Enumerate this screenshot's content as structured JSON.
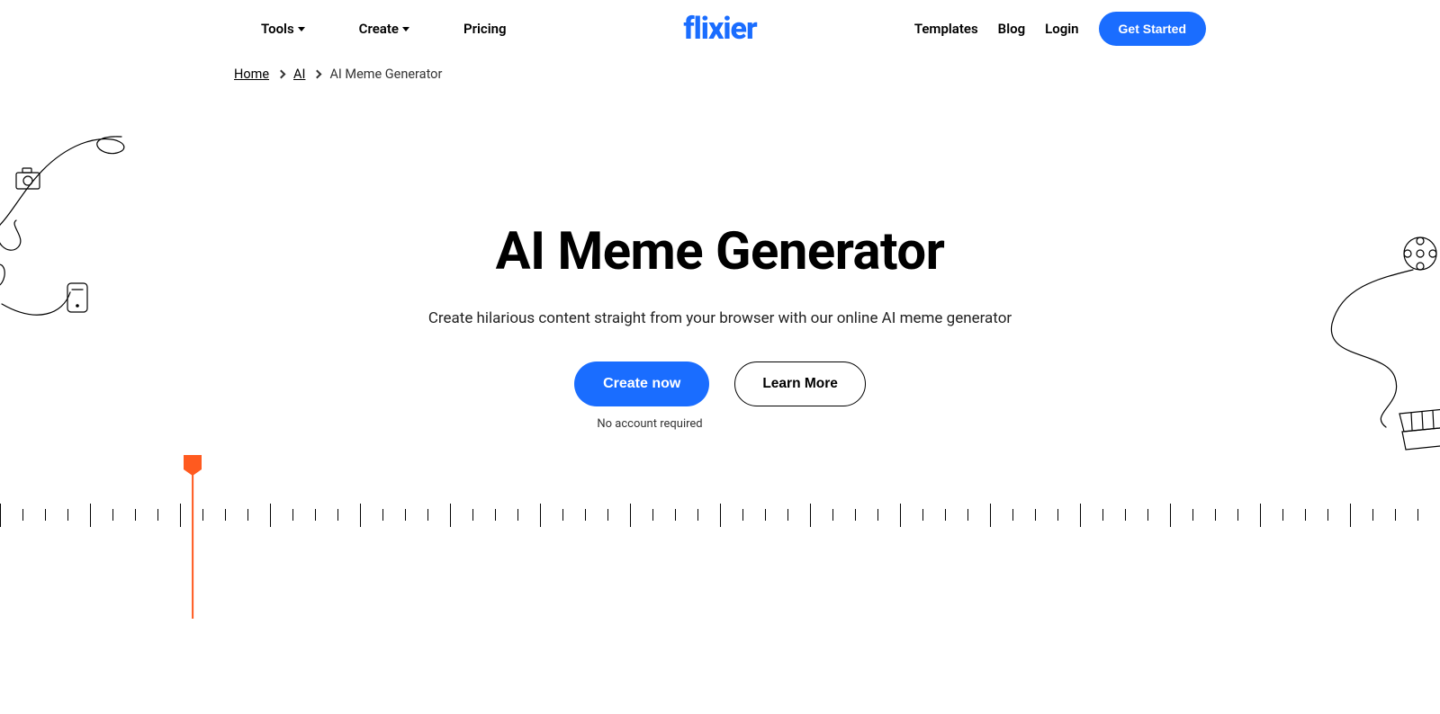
{
  "header": {
    "logo": "flixier",
    "nav_left": {
      "tools": "Tools",
      "create": "Create",
      "pricing": "Pricing"
    },
    "nav_right": {
      "templates": "Templates",
      "blog": "Blog",
      "login": "Login",
      "get_started": "Get Started"
    }
  },
  "breadcrumb": {
    "home": "Home",
    "ai": "AI",
    "current": "AI Meme Generator"
  },
  "hero": {
    "title": "AI Meme Generator",
    "subtitle": "Create hilarious content straight from your browser with our online AI meme generator",
    "cta_primary": "Create now",
    "cta_secondary": "Learn More",
    "note": "No account required"
  },
  "colors": {
    "accent": "#1a6dff",
    "playhead": "#ff5a1f"
  }
}
